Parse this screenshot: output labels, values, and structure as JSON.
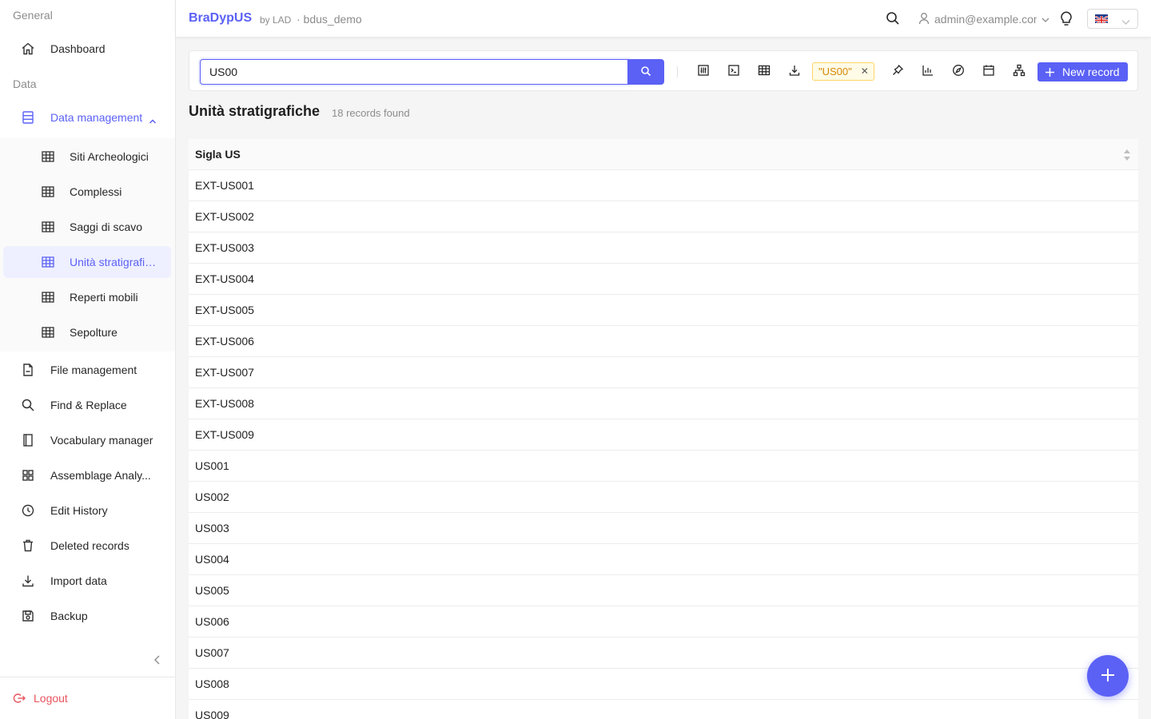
{
  "colors": {
    "accent": "#5b61f5",
    "danger": "#e8545e",
    "tag_bg": "#fffbe6",
    "tag_text": "#d48806"
  },
  "sidebar": {
    "section_general": "General",
    "section_data": "Data",
    "items": [
      {
        "label": "Dashboard",
        "icon": "home-icon"
      },
      {
        "label": "Data management",
        "icon": "database-icon"
      },
      {
        "label": "File management",
        "icon": "file-icon"
      },
      {
        "label": "Find & Replace",
        "icon": "search-icon"
      },
      {
        "label": "Vocabulary manager",
        "icon": "book-icon"
      },
      {
        "label": "Assemblage Analy...",
        "icon": "grid-icon"
      },
      {
        "label": "Edit History",
        "icon": "history-icon"
      },
      {
        "label": "Deleted records",
        "icon": "trash-icon"
      },
      {
        "label": "Import data",
        "icon": "import-icon"
      },
      {
        "label": "Backup",
        "icon": "save-icon"
      }
    ],
    "sub_items": [
      {
        "label": "Siti Archeologici",
        "icon": "table-icon"
      },
      {
        "label": "Complessi",
        "icon": "table-icon"
      },
      {
        "label": "Saggi di scavo",
        "icon": "table-icon"
      },
      {
        "label": "Unità stratigrafiche",
        "icon": "table-icon"
      },
      {
        "label": "Reperti mobili",
        "icon": "table-icon"
      },
      {
        "label": "Sepolture",
        "icon": "table-icon"
      }
    ],
    "logout": "Logout"
  },
  "header": {
    "brand": "BraDypUS",
    "by": "by LAD",
    "db": "· bdus_demo",
    "user": "admin@example.com",
    "language": "English"
  },
  "toolbar": {
    "search_value": "US00",
    "filter_tag": "\"US00\"",
    "new_record": "New record"
  },
  "main": {
    "title": "Unità stratigrafiche",
    "records_found": "18 records found",
    "column_header": "Sigla US",
    "rows": [
      "EXT-US001",
      "EXT-US002",
      "EXT-US003",
      "EXT-US004",
      "EXT-US005",
      "EXT-US006",
      "EXT-US007",
      "EXT-US008",
      "EXT-US009",
      "US001",
      "US002",
      "US003",
      "US004",
      "US005",
      "US006",
      "US007",
      "US008",
      "US009"
    ]
  }
}
